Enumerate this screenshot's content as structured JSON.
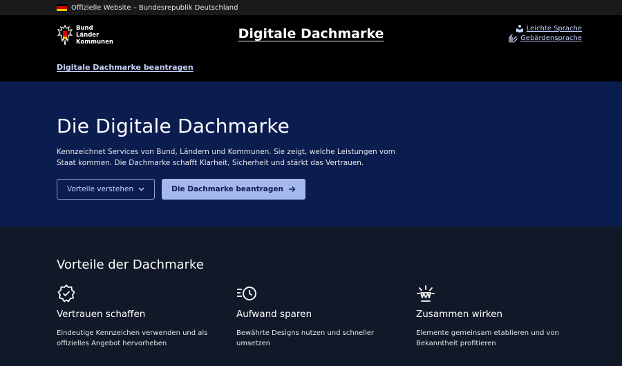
{
  "topbar": {
    "text": "Offizielle Website – Bundesrepublik Deutschland"
  },
  "header": {
    "logo_lines": [
      "Bund",
      "Länder",
      "Kommunen"
    ],
    "title": "Digitale Dachmarke",
    "lang_links": [
      "Leichte Sprache",
      "Gebärdensprache"
    ],
    "sub_nav": "Digitale Dachmarke beantragen"
  },
  "hero": {
    "title": "Die Digitale Dachmarke",
    "text": "Kennzeichnet Services von Bund, Ländern und Kommunen. Sie zeigt, welche Leistungen vom Staat kommen. Die Dachmarke schafft Klarheit, Sicherheit und stärkt das Vertrauen.",
    "btn_secondary": "Vorteile verstehen",
    "btn_primary": "Die Dachmarke beantragen"
  },
  "benefits": {
    "title": "Vorteile der Dachmarke",
    "cards": [
      {
        "icon": "badge-check-icon",
        "title": "Vertrauen schaffen",
        "text": "Eindeutige Kennzeichen verwenden und als offizielles Angebot hervorheben"
      },
      {
        "icon": "clock-fast-icon",
        "title": "Aufwand sparen",
        "text": "Bewährte Designs nutzen und schneller umsetzen"
      },
      {
        "icon": "sparkle-icon",
        "title": "Zusammen wirken",
        "text": "Elemente gemeinsam etablieren und von Bekanntheit profitieren"
      }
    ]
  },
  "colors": {
    "accent": "#a5b8ec",
    "hero_bg": "#0b1c4f",
    "header_bg": "#000000"
  }
}
